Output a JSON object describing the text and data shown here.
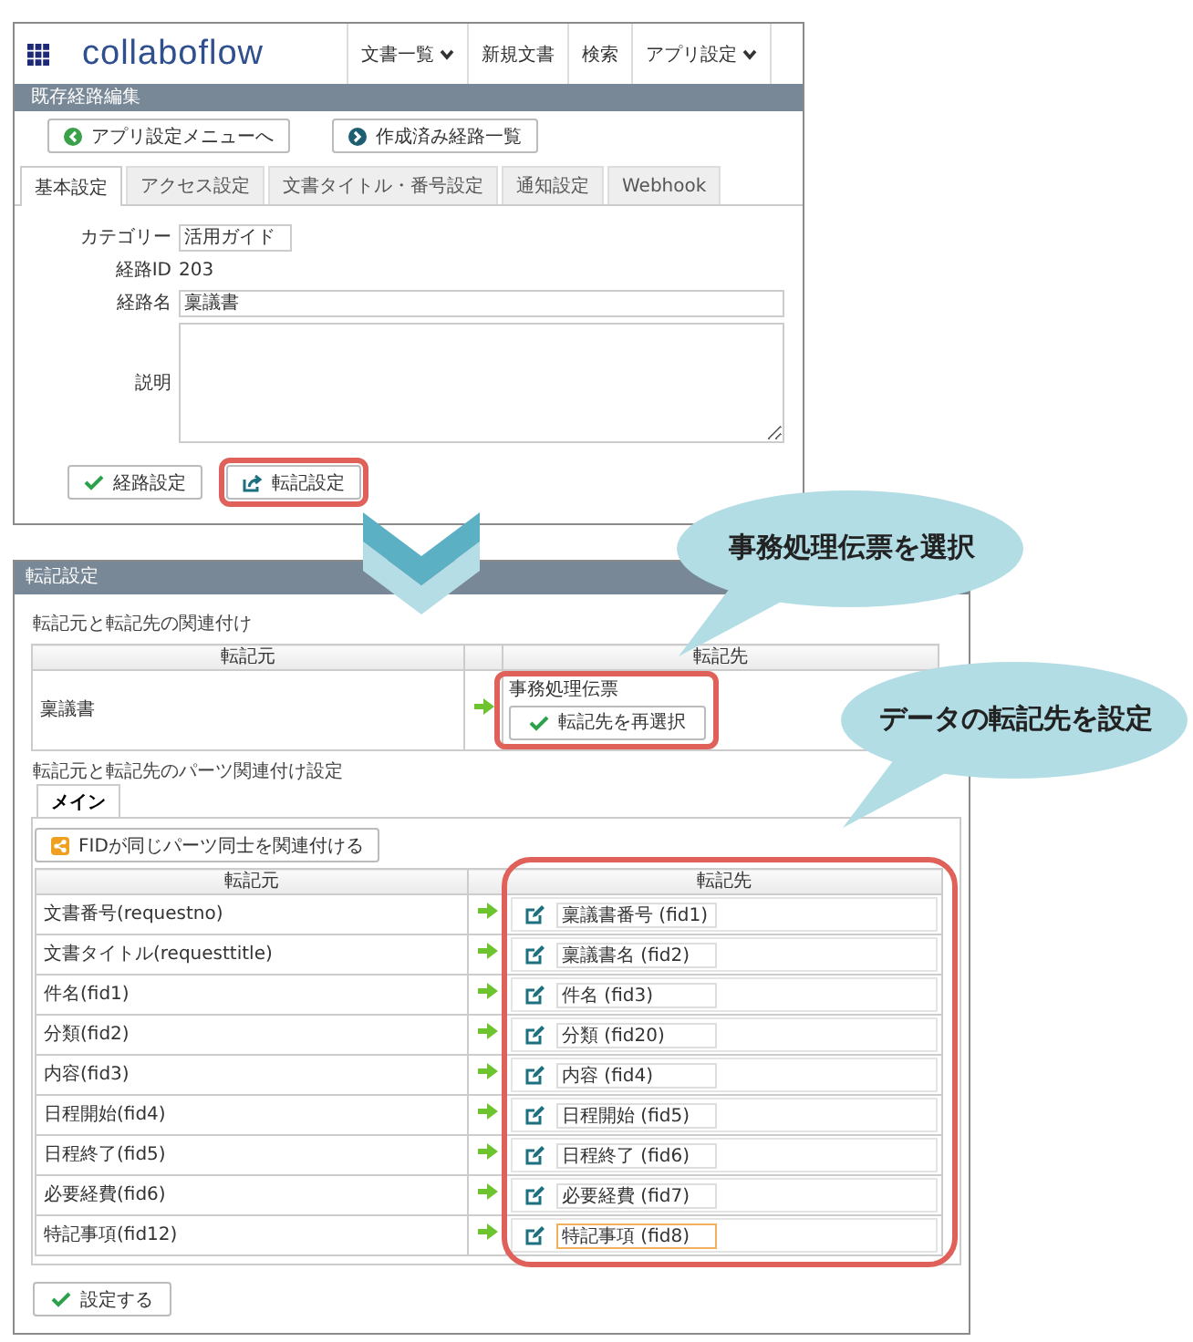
{
  "header": {
    "logo": "collaboflow",
    "nav": [
      {
        "label": "文書一覧",
        "dropdown": true
      },
      {
        "label": "新規文書",
        "dropdown": false
      },
      {
        "label": "検索",
        "dropdown": false
      },
      {
        "label": "アプリ設定",
        "dropdown": true
      }
    ]
  },
  "route_editor": {
    "title": "既存経路編集",
    "buttons": [
      {
        "label": "アプリ設定メニューへ",
        "kind": "back"
      },
      {
        "label": "作成済み経路一覧",
        "kind": "forward"
      }
    ],
    "tabs": [
      {
        "label": "基本設定",
        "selected": true
      },
      {
        "label": "アクセス設定",
        "selected": false
      },
      {
        "label": "文書タイトル・番号設定",
        "selected": false
      },
      {
        "label": "通知設定",
        "selected": false
      },
      {
        "label": "Webhook",
        "selected": false
      }
    ],
    "fields": [
      {
        "label": "カテゴリー",
        "kind": "short",
        "value": "活用ガイド"
      },
      {
        "label": "経路ID",
        "kind": "text",
        "value": "203"
      },
      {
        "label": "経路名",
        "kind": "long",
        "value": "稟議書"
      },
      {
        "label": "説明",
        "kind": "textarea"
      }
    ],
    "actions": [
      {
        "label": "経路設定",
        "kind": "check",
        "highlighted": false
      },
      {
        "label": "転記設定",
        "kind": "export",
        "highlighted": true
      }
    ]
  },
  "transfer": {
    "title": "転記設定",
    "link_section": {
      "label": "転記元と転記先の関連付け",
      "columns": [
        "転記元",
        "転記先"
      ],
      "source": "稟議書",
      "target": "事務処理伝票",
      "reselect_button": "転記先を再選択",
      "highlighted": true
    },
    "parts_section": {
      "label": "転記元と転記先のパーツ関連付け設定",
      "tabs": [
        {
          "label": "メイン",
          "selected": true
        }
      ],
      "auto_button": "FIDが同じパーツ同士を関連付ける",
      "columns": [
        "転記元",
        "転記先"
      ],
      "highlight_target": true,
      "rows": [
        {
          "source": "文書番号(requestno)",
          "target": "稟議書番号 (fid1)",
          "focused": false
        },
        {
          "source": "文書タイトル(requesttitle)",
          "target": "稟議書名 (fid2)",
          "focused": false
        },
        {
          "source": "件名(fid1)",
          "target": "件名 (fid3)",
          "focused": false
        },
        {
          "source": "分類(fid2)",
          "target": "分類 (fid20)",
          "focused": false
        },
        {
          "source": "内容(fid3)",
          "target": "内容 (fid4)",
          "focused": false
        },
        {
          "source": "日程開始(fid4)",
          "target": "日程開始 (fid5)",
          "focused": false
        },
        {
          "source": "日程終了(fid5)",
          "target": "日程終了 (fid6)",
          "focused": false
        },
        {
          "source": "必要経費(fid6)",
          "target": "必要経費 (fid7)",
          "focused": false
        },
        {
          "source": "特記事項(fid12)",
          "target": "特記事項 (fid8)",
          "focused": true
        }
      ]
    },
    "submit_button": "設定する"
  },
  "callouts": [
    {
      "text": "事務処理伝票を選択"
    },
    {
      "text": "データの転記先を設定"
    }
  ]
}
